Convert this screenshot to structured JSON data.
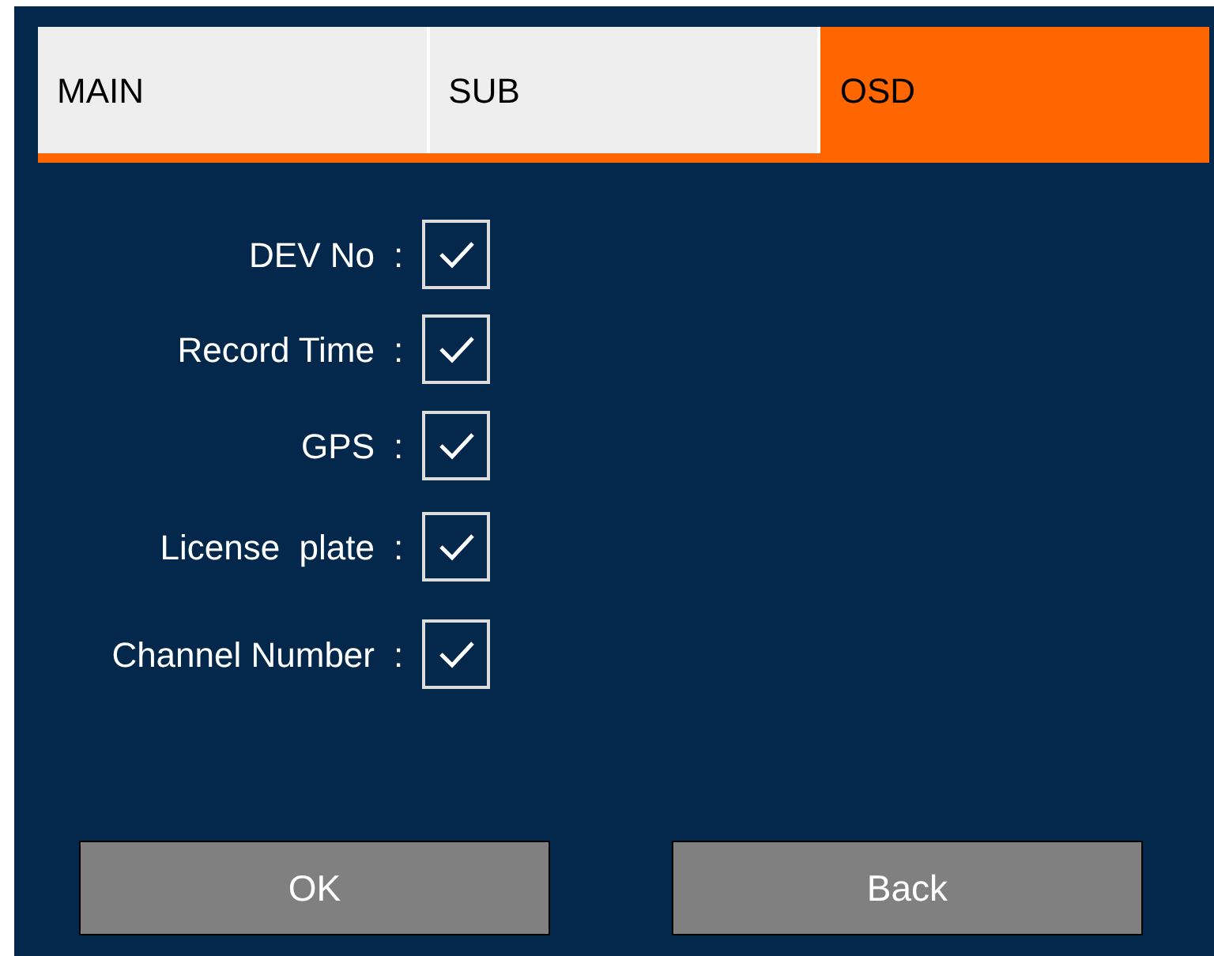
{
  "tabs": [
    {
      "label": "MAIN",
      "selected": false
    },
    {
      "label": "SUB",
      "selected": false
    },
    {
      "label": "OSD",
      "selected": true
    }
  ],
  "options": [
    {
      "label": "DEV No",
      "separator": ":",
      "checked": true
    },
    {
      "label": "Record Time",
      "separator": ":",
      "checked": true
    },
    {
      "label": "GPS",
      "separator": ":",
      "checked": true
    },
    {
      "label": "License  plate",
      "separator": ":",
      "checked": true
    },
    {
      "label": "Channel Number",
      "separator": ":",
      "checked": true
    }
  ],
  "buttons": [
    "OK",
    "Back"
  ]
}
